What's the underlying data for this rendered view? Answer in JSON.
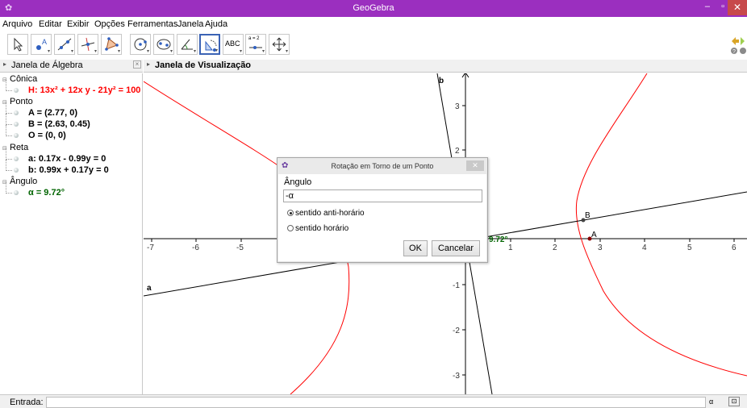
{
  "window": {
    "title": "GeoGebra",
    "min_glyph": "–",
    "max_glyph": "▫",
    "close_glyph": "✕"
  },
  "menu": [
    "Arquivo",
    "Editar",
    "Exibir",
    "Opções",
    "Ferramentas",
    "Janela",
    "Ajuda"
  ],
  "toolbar": {
    "tools": [
      "move",
      "point",
      "line",
      "perpendicular",
      "polygon",
      "circle",
      "ellipse",
      "angle",
      "rotate-around-point",
      "text",
      "slider",
      "move-graphics-view"
    ],
    "selected": "rotate-around-point",
    "text_tool_label": "ABC",
    "slider_tool_label": "a = 2"
  },
  "algebra_panel": {
    "title": "Janela de Álgebra",
    "categories": [
      {
        "name": "Cônica",
        "items": [
          {
            "text": "H: 13x² + 12x y - 21y² = 100",
            "color": "#ff0000"
          }
        ]
      },
      {
        "name": "Ponto",
        "items": [
          {
            "text": "A = (2.77, 0)",
            "color": "#000000"
          },
          {
            "text": "B = (2.63, 0.45)",
            "color": "#000000"
          },
          {
            "text": "O = (0, 0)",
            "color": "#000000"
          }
        ]
      },
      {
        "name": "Reta",
        "items": [
          {
            "text": "a: 0.17x - 0.99y = 0",
            "color": "#000000"
          },
          {
            "text": "b: 0.99x + 0.17y = 0",
            "color": "#000000"
          }
        ]
      },
      {
        "name": "Ângulo",
        "items": [
          {
            "text": "α = 9.72°",
            "color": "#006400"
          }
        ]
      }
    ]
  },
  "graphics_view": {
    "title": "Janela de Visualização",
    "x_ticks": [
      "-7",
      "-6",
      "-5",
      "1",
      "2",
      "3",
      "4",
      "5",
      "6"
    ],
    "y_ticks": [
      "3",
      "2",
      "-1",
      "-2",
      "-3"
    ],
    "labels": {
      "line_a": "a",
      "line_b": "b",
      "point_A": "A",
      "point_B": "B",
      "angle": "9.72°"
    },
    "colors": {
      "conic": "#ff0000",
      "angle": "#006400"
    }
  },
  "dialog": {
    "title": "Rotação em Torno de um Ponto",
    "angle_label": "Ângulo",
    "angle_value": "-α",
    "radio_ccw": "sentido anti-horário",
    "radio_cw": "sentido horário",
    "selected": "ccw",
    "ok": "OK",
    "cancel": "Cancelar"
  },
  "input_bar": {
    "label": "Entrada:",
    "value": "",
    "symbol_glyph": "α",
    "keyboard_glyph": "⊡"
  }
}
